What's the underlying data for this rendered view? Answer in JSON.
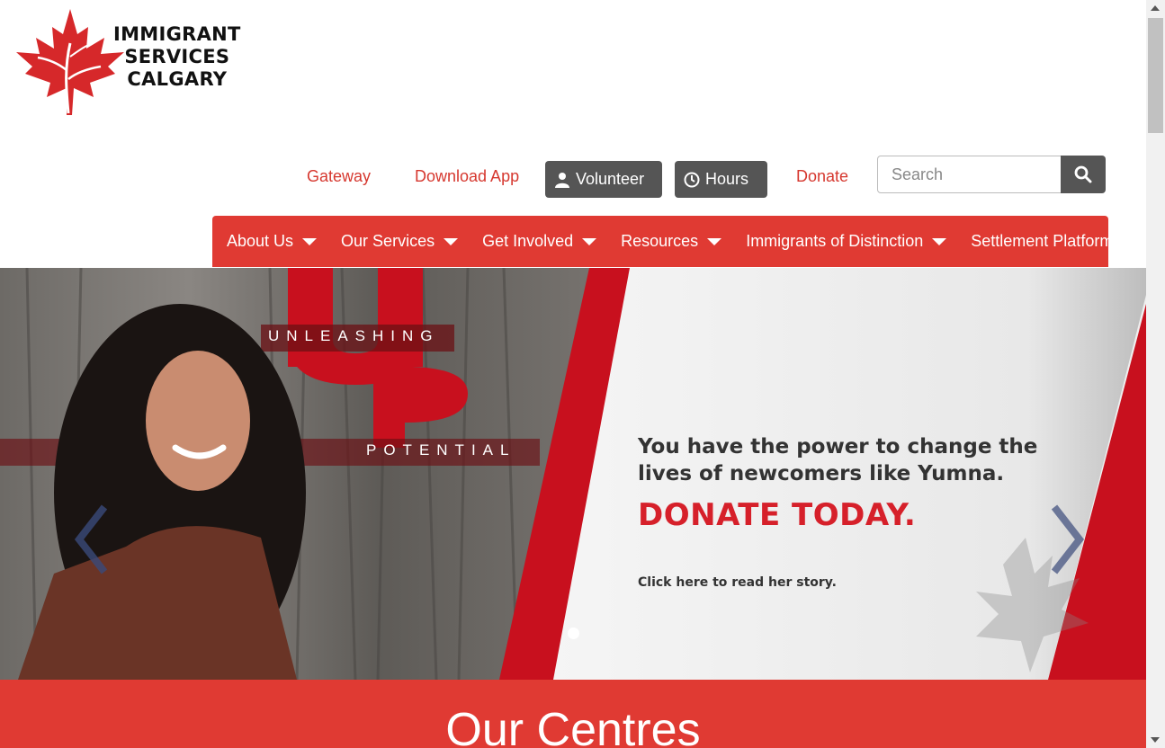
{
  "logo": {
    "lines": [
      "IMMIGRANT",
      "SERVICES",
      "CALGARY"
    ],
    "icon": "maple-leaf-icon"
  },
  "utility": {
    "gateway": "Gateway",
    "download_app": "Download App",
    "volunteer": "Volunteer",
    "hours": "Hours",
    "donate": "Donate"
  },
  "search": {
    "placeholder": "Search",
    "value": ""
  },
  "nav": {
    "items": [
      {
        "label": "About Us",
        "dropdown": true
      },
      {
        "label": "Our Services",
        "dropdown": true
      },
      {
        "label": "Get Involved",
        "dropdown": true
      },
      {
        "label": "Resources",
        "dropdown": true
      },
      {
        "label": "Immigrants of Distinction",
        "dropdown": true
      },
      {
        "label": "Settlement Platform",
        "dropdown": false
      }
    ]
  },
  "hero": {
    "unleashing": "UNLEASHING",
    "up": "UP",
    "potential": "POTENTIAL",
    "line1": "You have the power to change the",
    "line2": "lives of newcomers like Yumna.",
    "cta": "DONATE TODAY.",
    "story": "Click here to read her story."
  },
  "section": {
    "title": "Our Centres"
  },
  "colors": {
    "brand_red": "#e03a33",
    "link_red": "#d6382f",
    "button_gray": "#555555"
  }
}
